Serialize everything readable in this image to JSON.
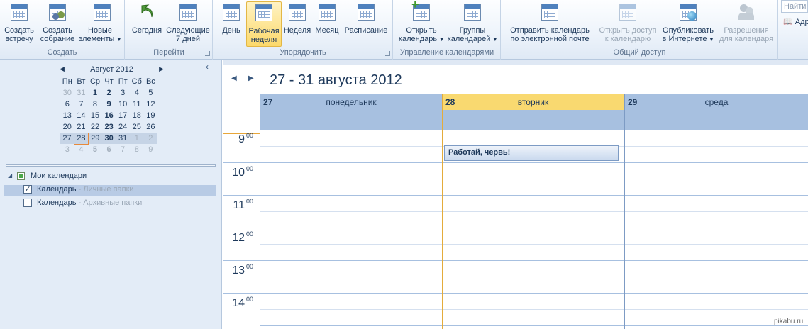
{
  "ribbon": {
    "groups": {
      "create": {
        "label": "Создать",
        "new_meeting": [
          "Создать",
          "встречу"
        ],
        "new_gathering": [
          "Создать",
          "собрание"
        ],
        "new_items": [
          "Новые",
          "элементы"
        ]
      },
      "goto": {
        "label": "Перейти",
        "today": "Сегодня",
        "next7": [
          "Следующие",
          "7 дней"
        ]
      },
      "arrange": {
        "label": "Упорядочить",
        "day": "День",
        "workweek": [
          "Рабочая",
          "неделя"
        ],
        "week": "Неделя",
        "month": "Месяц",
        "schedule": "Расписание"
      },
      "manage": {
        "label": "Управление календарями",
        "open": [
          "Открыть",
          "календарь"
        ],
        "groups": [
          "Группы",
          "календарей"
        ]
      },
      "share": {
        "label": "Общий доступ",
        "email": [
          "Отправить календарь",
          "по электронной почте"
        ],
        "open_access": [
          "Открыть доступ",
          "к календарю"
        ],
        "publish": [
          "Опубликовать",
          "в Интернете"
        ],
        "permissions": [
          "Разрешения",
          "для календаря"
        ]
      }
    },
    "search_placeholder": "Найти",
    "address_book": "Адр"
  },
  "nav": {
    "mini_calendar": {
      "title": "Август 2012",
      "weekdays": [
        "Пн",
        "Вт",
        "Ср",
        "Чт",
        "Пт",
        "Сб",
        "Вс"
      ],
      "weeks": [
        [
          "30",
          "31",
          "1",
          "2",
          "3",
          "4",
          "5"
        ],
        [
          "6",
          "7",
          "8",
          "9",
          "10",
          "11",
          "12"
        ],
        [
          "13",
          "14",
          "15",
          "16",
          "17",
          "18",
          "19"
        ],
        [
          "20",
          "21",
          "22",
          "23",
          "24",
          "25",
          "26"
        ],
        [
          "27",
          "28",
          "29",
          "30",
          "31",
          "1",
          "2"
        ],
        [
          "3",
          "4",
          "5",
          "6",
          "7",
          "8",
          "9"
        ]
      ]
    },
    "tree": {
      "root": "Мои календари",
      "items": [
        {
          "name": "Календарь",
          "sub": " - Личные папки",
          "checked": true
        },
        {
          "name": "Календарь",
          "sub": " - Архивные папки",
          "checked": false
        }
      ]
    }
  },
  "calendar": {
    "title": "27 - 31 августа 2012",
    "days": [
      {
        "num": "27",
        "weekday": "понедельник"
      },
      {
        "num": "28",
        "weekday": "вторник"
      },
      {
        "num": "29",
        "weekday": "среда"
      }
    ],
    "hours": [
      "9",
      "10",
      "11",
      "12",
      "13",
      "14"
    ],
    "minutes": "00",
    "appointment": "Работай, червь!"
  },
  "watermark": "pikabu.ru",
  "colors": {
    "accent": "#4f81bd",
    "today": "#f9d970",
    "header": "#a7c0e0"
  }
}
